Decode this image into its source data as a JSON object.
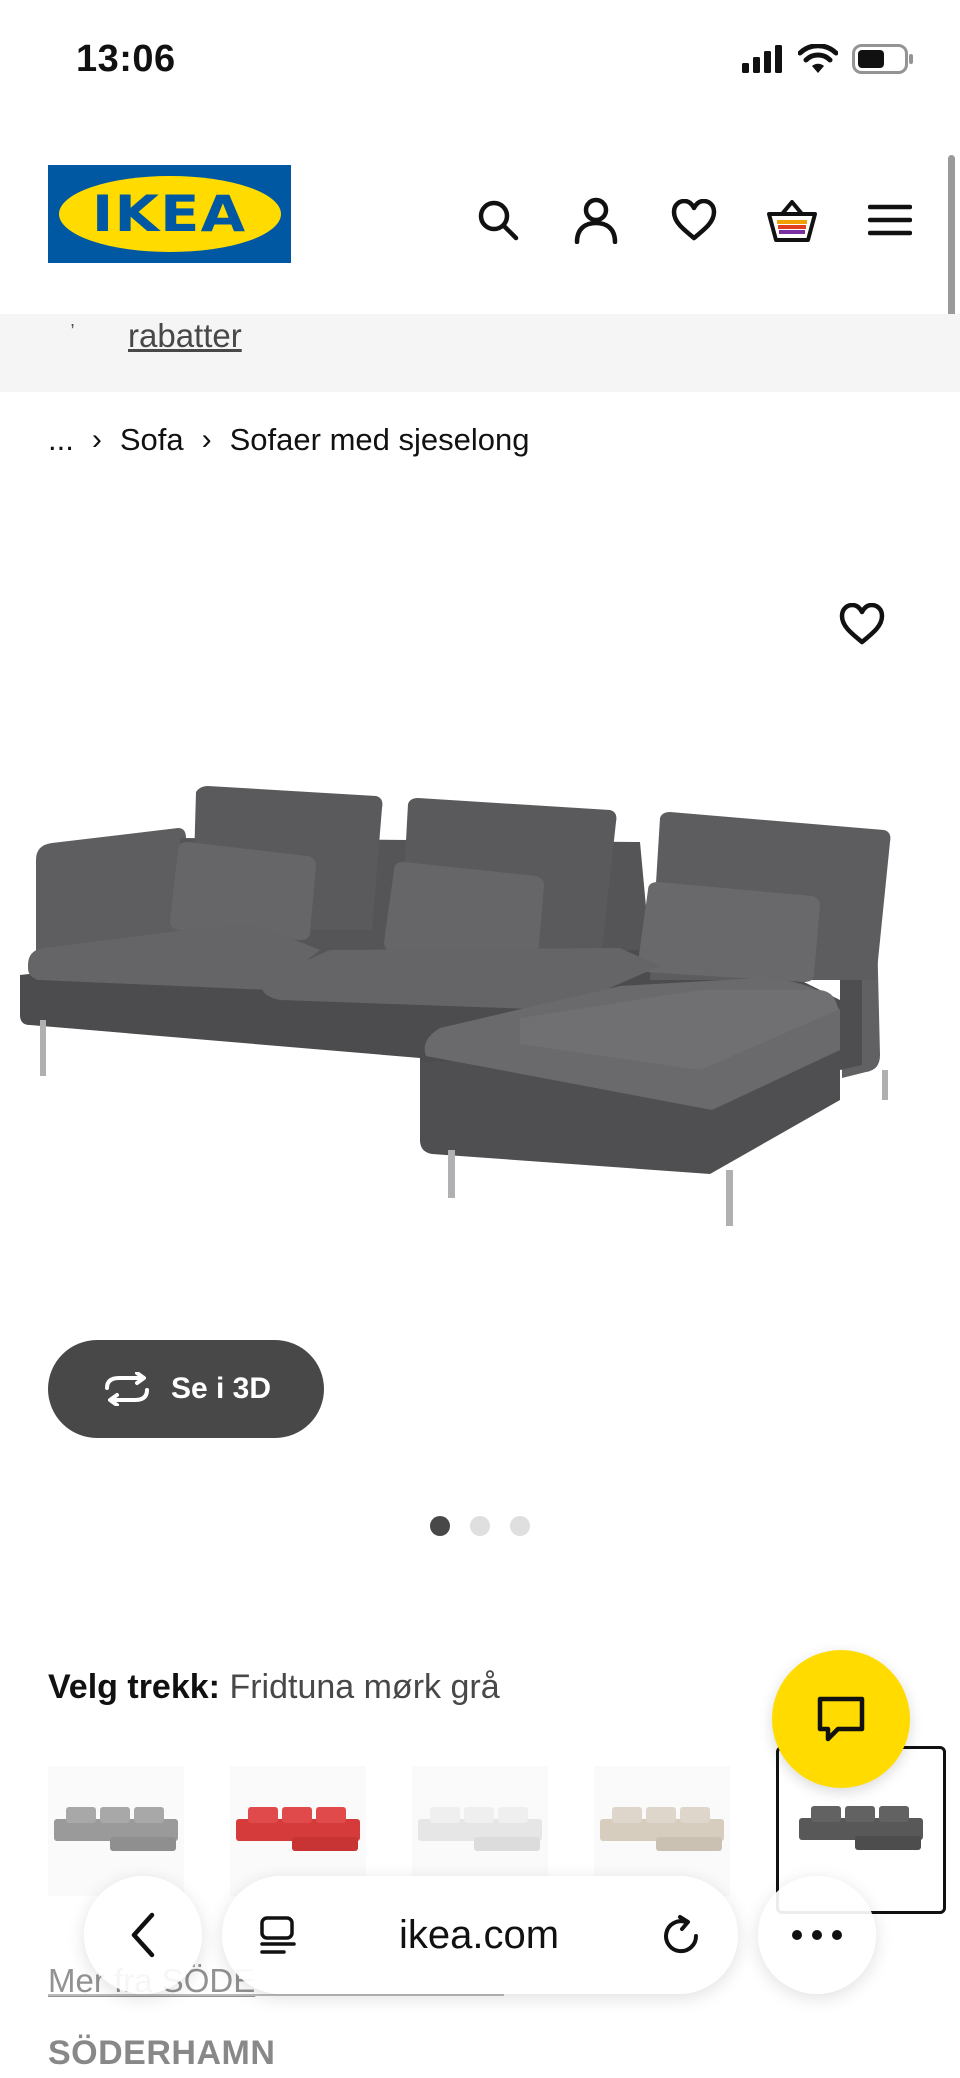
{
  "status_bar": {
    "time": "13:06"
  },
  "header": {
    "logo_text": "IKEA"
  },
  "promo": {
    "link_text": "rabatter"
  },
  "breadcrumb": {
    "ellipsis": "...",
    "items": [
      "Sofa",
      "Sofaer med sjeselong"
    ]
  },
  "gallery": {
    "view_3d_label": "Se i 3D",
    "dots": 3,
    "active_dot": 0
  },
  "cover": {
    "label": "Velg trekk:",
    "value": "Fridtuna mørk grå",
    "swatch_colors": [
      "#9a9a9a",
      "#d63b3b",
      "#ececec",
      "#d8cfc2",
      "#585858"
    ],
    "selected_index": 4
  },
  "below_fold": {
    "menu_text": "Mer fra SÖDE",
    "product_name": "SÖDERHAMN"
  },
  "browser": {
    "url": "ikea.com"
  },
  "colors": {
    "ikea_blue": "#0058a3",
    "ikea_yellow": "#ffdb00",
    "sofa": "#5a5a5c"
  }
}
